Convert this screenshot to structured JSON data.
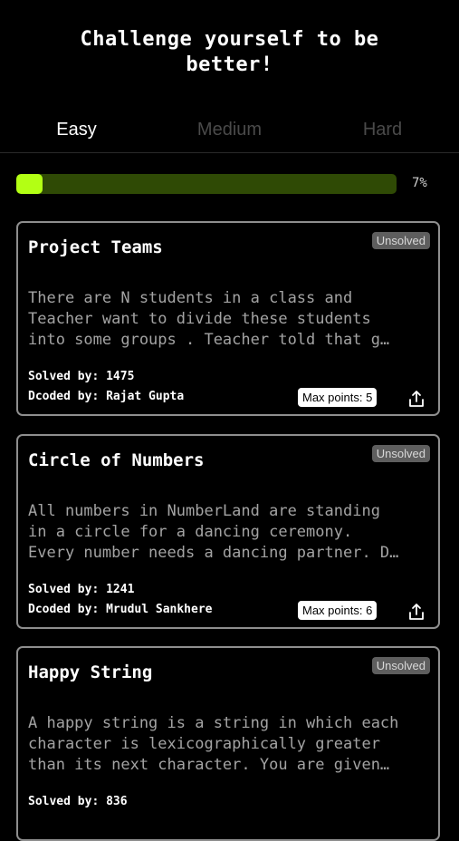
{
  "header": {
    "title_line1": "Challenge yourself to be",
    "title_line2": "better!"
  },
  "tabs": [
    {
      "label": "Easy",
      "active": true
    },
    {
      "label": "Medium",
      "active": false
    },
    {
      "label": "Hard",
      "active": false
    }
  ],
  "progress": {
    "value_percent": 7,
    "label": "7%",
    "fill_color": "#b3ff14",
    "track_color": "#2f4a05"
  },
  "problems": [
    {
      "title": "Project Teams",
      "status": "Unsolved",
      "desc_lines": [
        "There are N students in a class and",
        "Teacher want to divide these students",
        "into some groups . Teacher told  that g…"
      ],
      "solved_by": "Solved by: 1475",
      "dcoded_by": "Dcoded by: Rajat Gupta",
      "max_points": "Max points: 5"
    },
    {
      "title": "Circle of Numbers",
      "status": "Unsolved",
      "desc_lines": [
        "All numbers in NumberLand are standing",
        "in a circle for a dancing ceremony.",
        "Every number needs a dancing partner. D…"
      ],
      "solved_by": "Solved by: 1241",
      "dcoded_by": "Dcoded by: Mrudul Sankhere",
      "max_points": "Max points: 6"
    },
    {
      "title": "Happy String",
      "status": "Unsolved",
      "desc_lines": [
        "A happy string is a string in which each",
        "character is lexicographically greater",
        "than its next character. You are given…"
      ],
      "solved_by": "Solved by: 836",
      "dcoded_by": "",
      "max_points": ""
    }
  ],
  "icons": {
    "share": "share-icon"
  }
}
